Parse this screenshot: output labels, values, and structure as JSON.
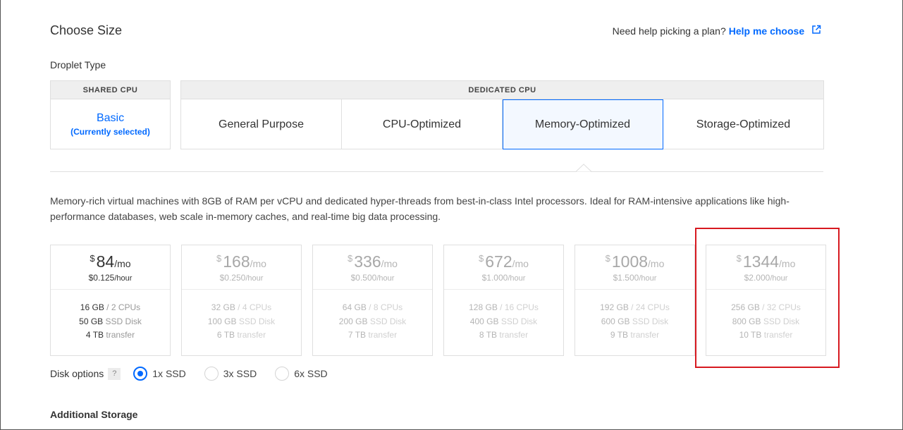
{
  "header": {
    "title": "Choose Size",
    "help_text": "Need help picking a plan?",
    "help_link": "Help me choose",
    "help_link_icon": "external-link-icon"
  },
  "droplet_type": {
    "label": "Droplet Type",
    "shared": {
      "heading": "SHARED CPU",
      "option_name": "Basic",
      "option_note": "(Currently selected)"
    },
    "dedicated": {
      "heading": "DEDICATED CPU",
      "tabs": [
        {
          "label": "General Purpose",
          "selected": false
        },
        {
          "label": "CPU-Optimized",
          "selected": false
        },
        {
          "label": "Memory-Optimized",
          "selected": true
        },
        {
          "label": "Storage-Optimized",
          "selected": false
        }
      ]
    }
  },
  "description": "Memory-rich virtual machines with 8GB of RAM per vCPU and dedicated hyper-threads from best-in-class Intel processors. Ideal for RAM-intensive applications like high-performance databases, web scale in-memory caches, and real-time big data processing.",
  "plans": [
    {
      "currency": "$",
      "amount": "84",
      "per": "/mo",
      "hourly": "$0.125",
      "hourly_unit": "/hour",
      "ram": "16 GB",
      "cpus": "/ 2 CPUs",
      "disk": "50 GB",
      "disk_type": "SSD Disk",
      "transfer": "4 TB",
      "transfer_label": "transfer",
      "available": true
    },
    {
      "currency": "$",
      "amount": "168",
      "per": "/mo",
      "hourly": "$0.250",
      "hourly_unit": "/hour",
      "ram": "32 GB",
      "cpus": "/ 4 CPUs",
      "disk": "100 GB",
      "disk_type": "SSD Disk",
      "transfer": "6 TB",
      "transfer_label": "transfer",
      "available": false
    },
    {
      "currency": "$",
      "amount": "336",
      "per": "/mo",
      "hourly": "$0.500",
      "hourly_unit": "/hour",
      "ram": "64 GB",
      "cpus": "/ 8 CPUs",
      "disk": "200 GB",
      "disk_type": "SSD Disk",
      "transfer": "7 TB",
      "transfer_label": "transfer",
      "available": false
    },
    {
      "currency": "$",
      "amount": "672",
      "per": "/mo",
      "hourly": "$1.000",
      "hourly_unit": "/hour",
      "ram": "128 GB",
      "cpus": "/ 16 CPUs",
      "disk": "400 GB",
      "disk_type": "SSD Disk",
      "transfer": "8 TB",
      "transfer_label": "transfer",
      "available": false
    },
    {
      "currency": "$",
      "amount": "1008",
      "per": "/mo",
      "hourly": "$1.500",
      "hourly_unit": "/hour",
      "ram": "192 GB",
      "cpus": "/ 24 CPUs",
      "disk": "600 GB",
      "disk_type": "SSD Disk",
      "transfer": "9 TB",
      "transfer_label": "transfer",
      "available": false
    },
    {
      "currency": "$",
      "amount": "1344",
      "per": "/mo",
      "hourly": "$2.000",
      "hourly_unit": "/hour",
      "ram": "256 GB",
      "cpus": "/ 32 CPUs",
      "disk": "800 GB",
      "disk_type": "SSD Disk",
      "transfer": "10 TB",
      "transfer_label": "transfer",
      "available": false
    }
  ],
  "disk_options": {
    "label": "Disk options",
    "help": "?",
    "options": [
      {
        "label": "1x SSD",
        "checked": true
      },
      {
        "label": "3x SSD",
        "checked": false
      },
      {
        "label": "6x SSD",
        "checked": false
      }
    ]
  },
  "additional_storage": "Additional Storage",
  "colors": {
    "accent": "#0069ff",
    "highlight": "#d71920",
    "border": "#dfdfdf"
  }
}
